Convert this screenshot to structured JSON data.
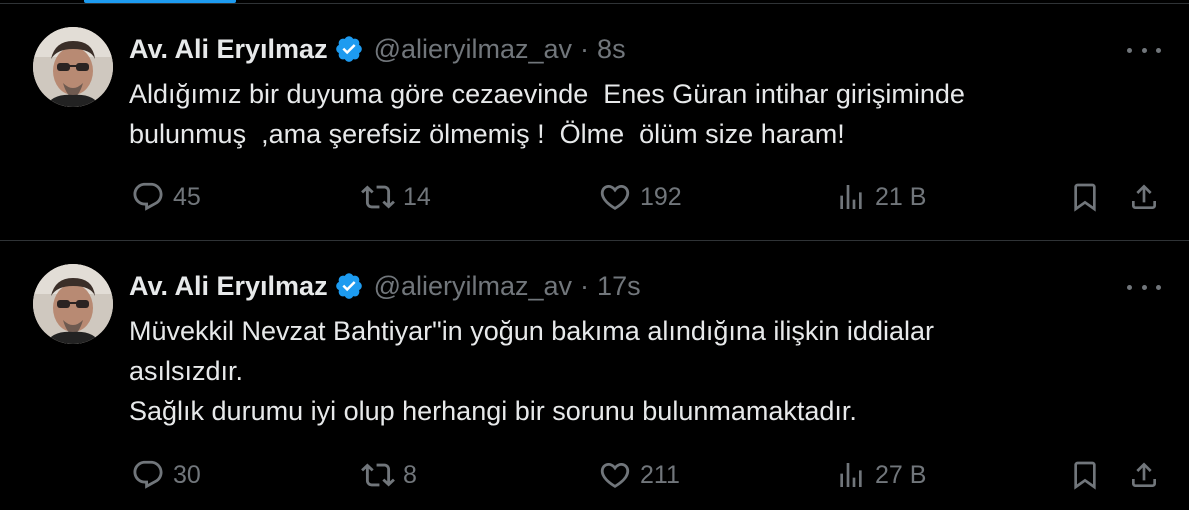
{
  "colors": {
    "background": "#000000",
    "text_primary": "#e7e9ea",
    "text_secondary": "#71767b",
    "divider": "#2f3336",
    "verified_badge": "#1d9bf0",
    "tab_indicator": "#1d9bf0"
  },
  "tweets": [
    {
      "author": {
        "display_name": "Av. Ali Eryılmaz",
        "handle": "@alieryilmaz_av",
        "verified": true,
        "avatar_icon": "avatar-photo"
      },
      "separator": "·",
      "time": "8s",
      "text_lines": [
        "Aldığımız bir duyuma göre cezaevinde  Enes Güran intihar girişiminde",
        "bulunmuş  ,ama şerefsiz ölmemiş !  Ölme  ölüm size haram!"
      ],
      "stats": {
        "replies": "45",
        "retweets": "14",
        "likes": "192",
        "views": "21 B"
      },
      "icons": [
        "reply-icon",
        "retweet-icon",
        "like-icon",
        "views-icon",
        "bookmark-icon",
        "share-icon",
        "more-icon"
      ]
    },
    {
      "author": {
        "display_name": "Av. Ali Eryılmaz",
        "handle": "@alieryilmaz_av",
        "verified": true,
        "avatar_icon": "avatar-photo"
      },
      "separator": "·",
      "time": "17s",
      "text_lines": [
        "Müvekkil Nevzat Bahtiyar\"in yoğun bakıma alındığına ilişkin iddialar",
        "asılsızdır.",
        "Sağlık durumu iyi olup herhangi bir sorunu bulunmamaktadır."
      ],
      "stats": {
        "replies": "30",
        "retweets": "8",
        "likes": "211",
        "views": "27 B"
      },
      "icons": [
        "reply-icon",
        "retweet-icon",
        "like-icon",
        "views-icon",
        "bookmark-icon",
        "share-icon",
        "more-icon"
      ]
    }
  ]
}
